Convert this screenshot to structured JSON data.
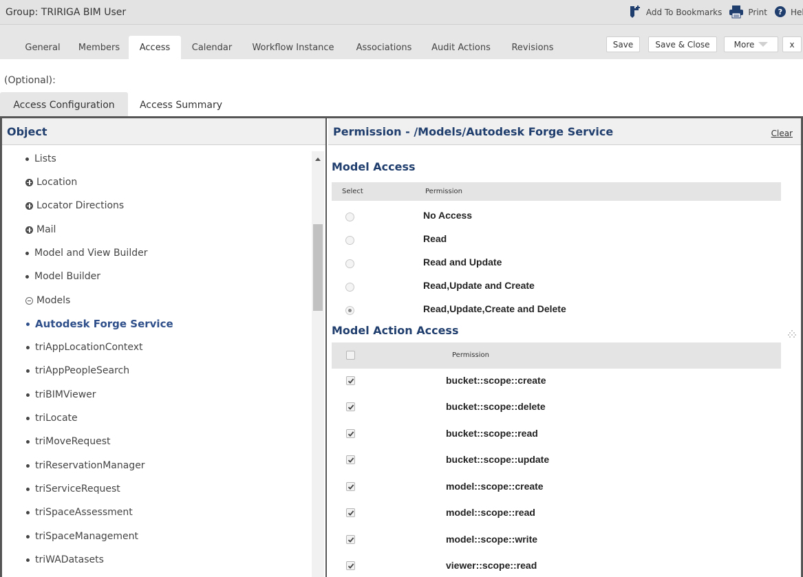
{
  "window": {
    "title": "Group: TRIRIGA BIM User"
  },
  "toolbar": {
    "bookmarks_label": "Add To Bookmarks",
    "print_label": "Print",
    "help_label": "Help"
  },
  "tabs": [
    {
      "label": "General"
    },
    {
      "label": "Members"
    },
    {
      "label": "Access",
      "active": true
    },
    {
      "label": "Calendar"
    },
    {
      "label": "Workflow Instance"
    },
    {
      "label": "Associations"
    },
    {
      "label": "Audit Actions"
    },
    {
      "label": "Revisions"
    }
  ],
  "actions": {
    "save": "Save",
    "save_close": "Save & Close",
    "more": "More",
    "close": "x"
  },
  "optional_label": "(Optional):",
  "subtabs": [
    {
      "label": "Access Configuration",
      "active": true
    },
    {
      "label": "Access Summary"
    }
  ],
  "object_panel": {
    "header": "Object",
    "items": [
      {
        "label": "Lists",
        "type": "leaf",
        "indent": 0
      },
      {
        "label": "Location",
        "type": "expand",
        "indent": 0
      },
      {
        "label": "Locator Directions",
        "type": "expand",
        "indent": 0
      },
      {
        "label": "Mail",
        "type": "expand",
        "indent": 0
      },
      {
        "label": "Model and View Builder",
        "type": "leaf",
        "indent": 0
      },
      {
        "label": "Model Builder",
        "type": "leaf",
        "indent": 0
      },
      {
        "label": "Models",
        "type": "collapse",
        "indent": 0
      },
      {
        "label": "Autodesk Forge Service",
        "type": "leaf",
        "indent": 1,
        "selected": true
      },
      {
        "label": "triAppLocationContext",
        "type": "leaf",
        "indent": 1
      },
      {
        "label": "triAppPeopleSearch",
        "type": "leaf",
        "indent": 1
      },
      {
        "label": "triBIMViewer",
        "type": "leaf",
        "indent": 1
      },
      {
        "label": "triLocate",
        "type": "leaf",
        "indent": 1
      },
      {
        "label": "triMoveRequest",
        "type": "leaf",
        "indent": 1
      },
      {
        "label": "triReservationManager",
        "type": "leaf",
        "indent": 1
      },
      {
        "label": "triServiceRequest",
        "type": "leaf",
        "indent": 1
      },
      {
        "label": "triSpaceAssessment",
        "type": "leaf",
        "indent": 1
      },
      {
        "label": "triSpaceManagement",
        "type": "leaf",
        "indent": 1
      },
      {
        "label": "triWADatasets",
        "type": "leaf",
        "indent": 1
      }
    ]
  },
  "permission_panel": {
    "header": "Permission - /Models/Autodesk Forge Service",
    "clear_label": "Clear",
    "model_access": {
      "title": "Model Access",
      "col_select": "Select",
      "col_permission": "Permission",
      "options": [
        {
          "label": "No Access",
          "checked": false
        },
        {
          "label": "Read",
          "checked": false
        },
        {
          "label": "Read and Update",
          "checked": false
        },
        {
          "label": "Read,Update and Create",
          "checked": false
        },
        {
          "label": "Read,Update,Create and Delete",
          "checked": true
        }
      ]
    },
    "model_action_access": {
      "title": "Model Action Access",
      "col_permission": "Permission",
      "select_all_checked": false,
      "actions": [
        {
          "label": "bucket::scope::create",
          "checked": true
        },
        {
          "label": "bucket::scope::delete",
          "checked": true
        },
        {
          "label": "bucket::scope::read",
          "checked": true
        },
        {
          "label": "bucket::scope::update",
          "checked": true
        },
        {
          "label": "model::scope::create",
          "checked": true
        },
        {
          "label": "model::scope::read",
          "checked": true
        },
        {
          "label": "model::scope::write",
          "checked": true
        },
        {
          "label": "viewer::scope::read",
          "checked": true
        }
      ]
    }
  }
}
